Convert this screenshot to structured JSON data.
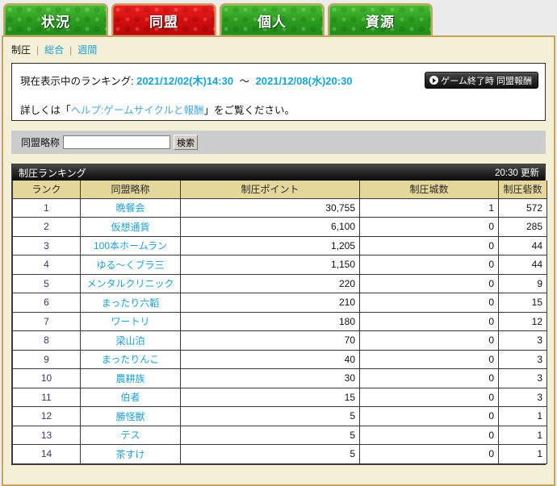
{
  "tabs": [
    {
      "label": "状況",
      "state": "green",
      "name": "tab-status"
    },
    {
      "label": "同盟",
      "state": "red",
      "name": "tab-alliance"
    },
    {
      "label": "個人",
      "state": "green",
      "name": "tab-personal"
    },
    {
      "label": "資源",
      "state": "green",
      "name": "tab-resource"
    }
  ],
  "subnav": {
    "current": "制圧",
    "links": [
      "総合",
      "週間"
    ]
  },
  "info": {
    "label": "現在表示中のランキング:",
    "date_from": "2021/12/02(木)14:30",
    "tilde": "～",
    "date_to": "2021/12/08(水)20:30",
    "note_prefix": "詳しくは「",
    "note_link": "ヘルプ:ゲームサイクルと報酬",
    "note_suffix": "」をご覧ください。",
    "reward_button": "ゲーム終了時 同盟報酬",
    "reward_icon": "play-circle-icon"
  },
  "search": {
    "label": "同盟略称",
    "value": "",
    "placeholder": "",
    "button": "検索"
  },
  "ranking": {
    "title": "制圧ランキング",
    "updated": "20:30 更新",
    "columns": [
      "ランク",
      "同盟略称",
      "制圧ポイント",
      "制圧城数",
      "制圧砦数"
    ],
    "rows": [
      {
        "rank": "1",
        "ally": "晩餐会",
        "points": "30,755",
        "castles": "1",
        "forts": "572"
      },
      {
        "rank": "2",
        "ally": "仮想通貨",
        "points": "6,100",
        "castles": "0",
        "forts": "285"
      },
      {
        "rank": "3",
        "ally": "100本ホームラン",
        "points": "1,205",
        "castles": "0",
        "forts": "44"
      },
      {
        "rank": "4",
        "ally": "ゆる～くブラ三",
        "points": "1,150",
        "castles": "0",
        "forts": "44"
      },
      {
        "rank": "5",
        "ally": "メンタルクリニック",
        "points": "220",
        "castles": "0",
        "forts": "9"
      },
      {
        "rank": "6",
        "ally": "まったり六韜",
        "points": "210",
        "castles": "0",
        "forts": "15"
      },
      {
        "rank": "7",
        "ally": "ワートリ",
        "points": "180",
        "castles": "0",
        "forts": "12"
      },
      {
        "rank": "8",
        "ally": "梁山泊",
        "points": "70",
        "castles": "0",
        "forts": "3"
      },
      {
        "rank": "9",
        "ally": "まったりんこ",
        "points": "40",
        "castles": "0",
        "forts": "3"
      },
      {
        "rank": "10",
        "ally": "農耕族",
        "points": "30",
        "castles": "0",
        "forts": "3"
      },
      {
        "rank": "11",
        "ally": "伯者",
        "points": "15",
        "castles": "0",
        "forts": "3"
      },
      {
        "rank": "12",
        "ally": "勝怪獣",
        "points": "5",
        "castles": "0",
        "forts": "1"
      },
      {
        "rank": "13",
        "ally": "テス",
        "points": "5",
        "castles": "0",
        "forts": "1"
      },
      {
        "rank": "14",
        "ally": "茶すけ",
        "points": "5",
        "castles": "0",
        "forts": "1"
      }
    ]
  },
  "colors": {
    "tab_green": "#2fa322",
    "tab_active_red": "#d81414",
    "panel_cream": "#f4f0d8",
    "frame_gold": "#c7a45a",
    "link_blue": "#1b9fd8",
    "header_tan": "#e4d79a",
    "title_black": "#0b0b0b"
  }
}
